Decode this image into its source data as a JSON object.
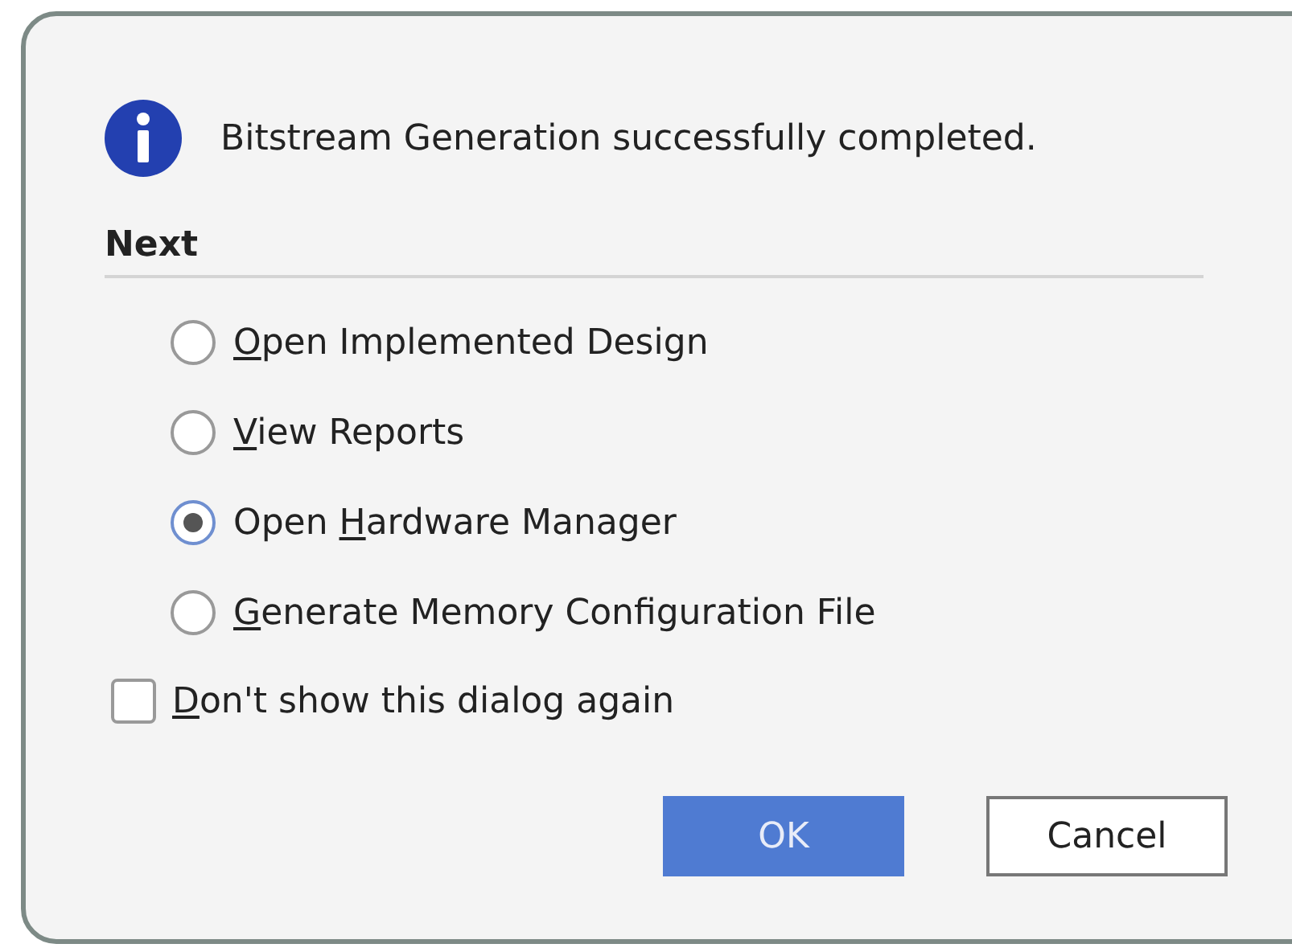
{
  "message": "Bitstream Generation successfully completed.",
  "section": {
    "title": "Next"
  },
  "options": [
    {
      "mnemonic": "O",
      "rest": "pen Implemented Design",
      "selected": false
    },
    {
      "mnemonic": "V",
      "rest": "iew Reports",
      "selected": false
    },
    {
      "prefix": "Open ",
      "mnemonic": "H",
      "rest": "ardware Manager",
      "selected": true
    },
    {
      "mnemonic": "G",
      "rest": "enerate Memory Configuration File",
      "selected": false
    }
  ],
  "dont_show": {
    "mnemonic": "D",
    "rest": "on't show this dialog again",
    "checked": false
  },
  "buttons": [
    {
      "label": "OK",
      "kind": "primary"
    },
    {
      "label": "Cancel",
      "kind": "secondary"
    }
  ]
}
